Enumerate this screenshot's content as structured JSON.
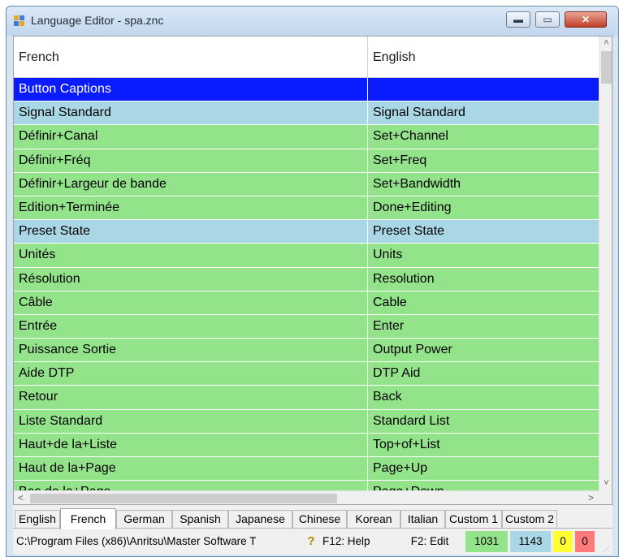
{
  "window": {
    "title": "Language Editor - spa.znc",
    "controls": {
      "minimize": "▬",
      "maximize": "▭",
      "close": "✕"
    }
  },
  "grid": {
    "columns": [
      "French",
      "English"
    ],
    "rows": [
      {
        "french": "Button Captions",
        "english": "",
        "kind": "selected"
      },
      {
        "french": "Signal Standard",
        "english": "Signal Standard",
        "kind": "section"
      },
      {
        "french": "Définir+Canal",
        "english": "Set+Channel",
        "kind": "item"
      },
      {
        "french": "Définir+Fréq",
        "english": "Set+Freq",
        "kind": "item"
      },
      {
        "french": "Définir+Largeur de bande",
        "english": "Set+Bandwidth",
        "kind": "item"
      },
      {
        "french": "Edition+Terminée",
        "english": "Done+Editing",
        "kind": "item"
      },
      {
        "french": "Preset State",
        "english": "Preset State",
        "kind": "section"
      },
      {
        "french": "Unités",
        "english": "Units",
        "kind": "item"
      },
      {
        "french": "Résolution",
        "english": "Resolution",
        "kind": "item"
      },
      {
        "french": "Câble",
        "english": "Cable",
        "kind": "item"
      },
      {
        "french": "Entrée",
        "english": "Enter",
        "kind": "item"
      },
      {
        "french": "Puissance Sortie",
        "english": "Output Power",
        "kind": "item"
      },
      {
        "french": "Aide DTP",
        "english": "DTP Aid",
        "kind": "item"
      },
      {
        "french": "Retour",
        "english": "Back",
        "kind": "item"
      },
      {
        "french": "Liste Standard",
        "english": "Standard List",
        "kind": "item"
      },
      {
        "french": "Haut+de la+Liste",
        "english": "Top+of+List",
        "kind": "item"
      },
      {
        "french": "Haut de la+Page",
        "english": "Page+Up",
        "kind": "item"
      },
      {
        "french": "Bas de la+Page",
        "english": "Page+Down",
        "kind": "item"
      }
    ]
  },
  "scroll": {
    "up": "˄",
    "down": "˅",
    "left": "<",
    "right": ">"
  },
  "tabs": [
    {
      "label": "English",
      "active": false
    },
    {
      "label": "French",
      "active": true
    },
    {
      "label": "German",
      "active": false
    },
    {
      "label": "Spanish",
      "active": false
    },
    {
      "label": "Japanese",
      "active": false
    },
    {
      "label": "Chinese",
      "active": false
    },
    {
      "label": "Korean",
      "active": false
    },
    {
      "label": "Italian",
      "active": false
    },
    {
      "label": "Custom 1",
      "active": false
    },
    {
      "label": "Custom 2",
      "active": false
    }
  ],
  "status": {
    "path": "C:\\Program Files (x86)\\Anritsu\\Master Software T",
    "help_icon": "?",
    "help": "F12:  Help",
    "edit": "F2:  Edit",
    "counts": {
      "green": "1031",
      "blue": "1143",
      "yellow": "0",
      "red": "0"
    }
  },
  "colors": {
    "item_row": "#93e38b",
    "section_row": "#aad7e6",
    "selected_row": "#0a1bff",
    "yellow_count": "#ffff33",
    "red_count": "#ff7b7b"
  }
}
